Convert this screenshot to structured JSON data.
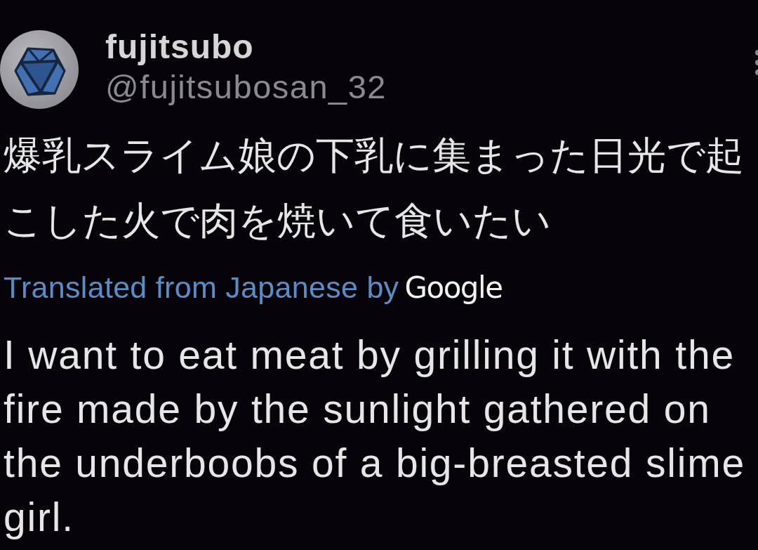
{
  "tweet": {
    "author": {
      "display_name": "fujitsubo",
      "handle": "@fujitsubosan_32"
    },
    "text": "爆乳スライム娘の下乳に集まった日光で起こした火で肉を焼いて食いたい",
    "translation": {
      "label": "Translated from Japanese by",
      "provider": "Google",
      "text": "I want to eat meat by grilling it with the fire made by the sunlight gathered on the underboobs of a big-breasted slime girl."
    }
  }
}
